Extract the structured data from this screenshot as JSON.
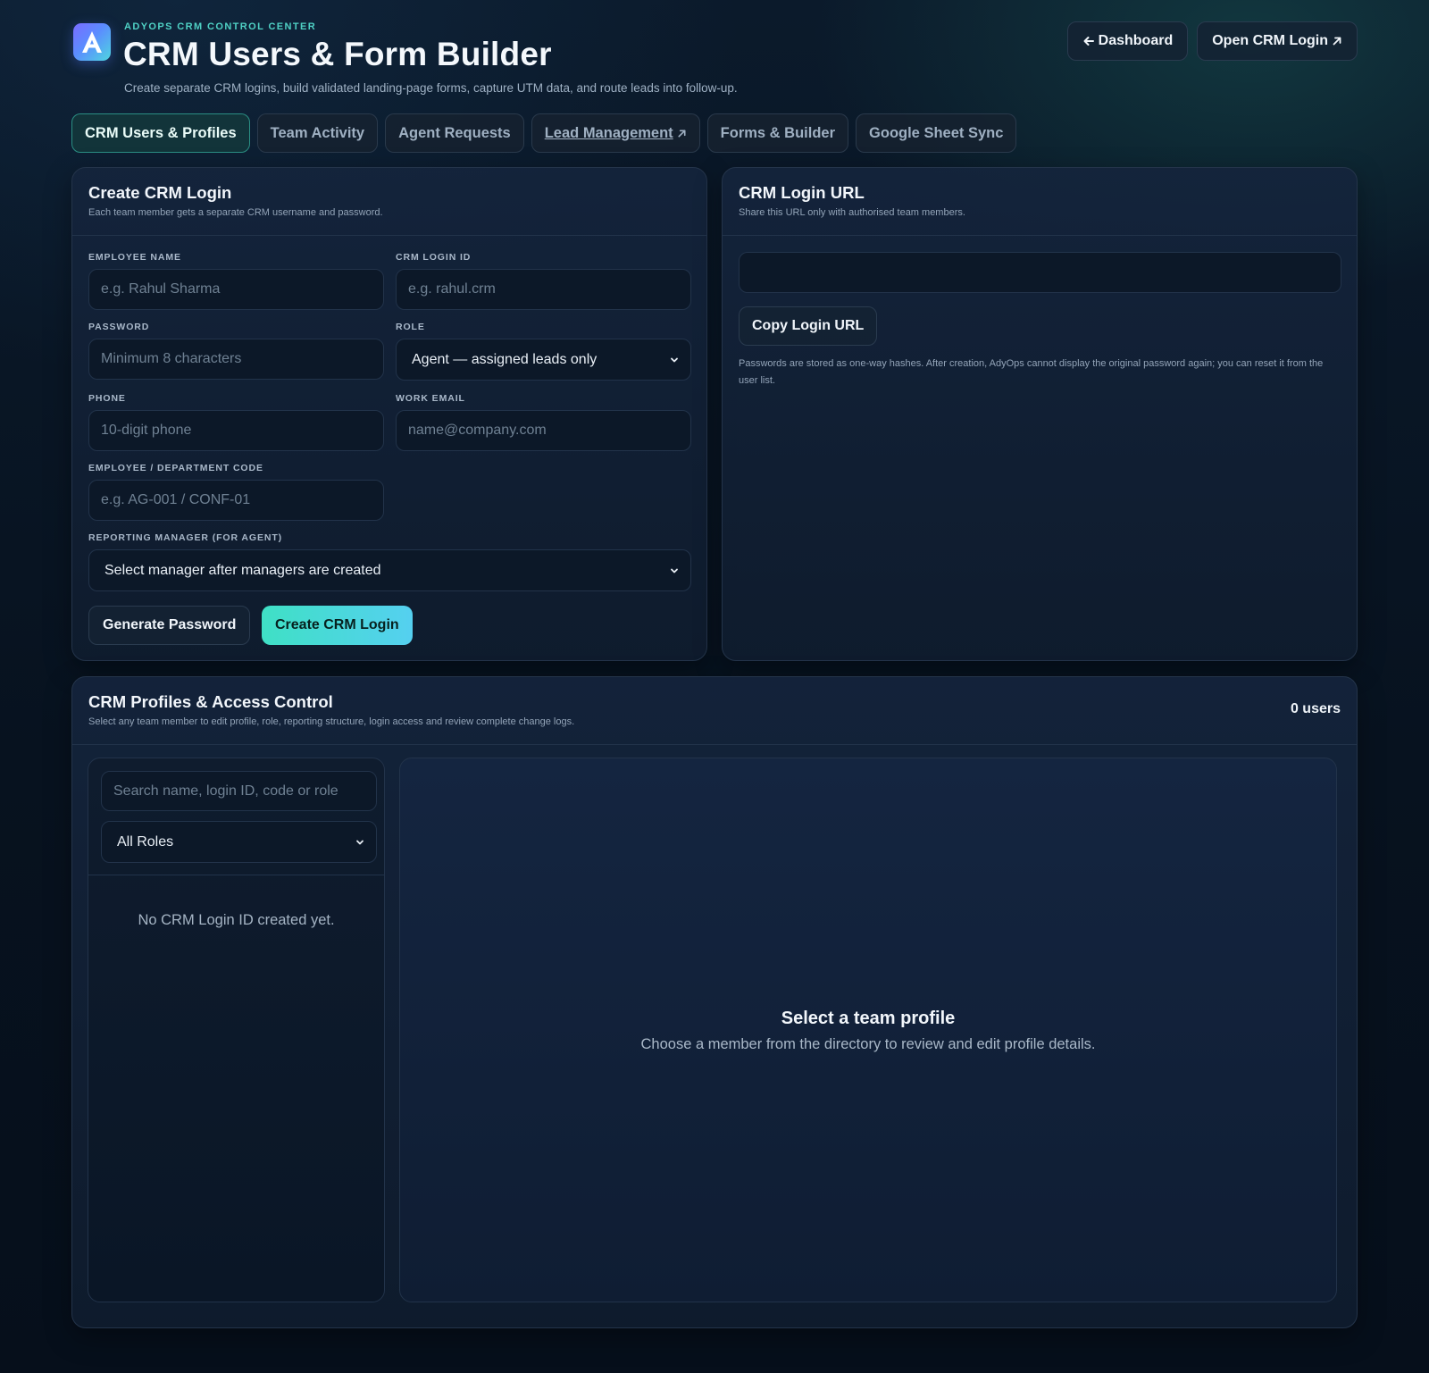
{
  "header": {
    "eyebrow": "ADYOPS CRM CONTROL CENTER",
    "title": "CRM Users & Form Builder",
    "subtitle": "Create separate CRM logins, build validated landing-page forms, capture UTM data, and route leads into follow-up.",
    "dashboard_label": "Dashboard",
    "open_login_label": "Open CRM Login"
  },
  "tabs": [
    {
      "label": "CRM Users & Profiles",
      "active": true
    },
    {
      "label": "Team Activity"
    },
    {
      "label": "Agent Requests"
    },
    {
      "label": "Lead Management",
      "external": true
    },
    {
      "label": "Forms & Builder"
    },
    {
      "label": "Google Sheet Sync"
    }
  ],
  "create_login": {
    "title": "Create CRM Login",
    "subtitle": "Each team member gets a separate CRM username and password.",
    "fields": {
      "employee_name": {
        "label": "EMPLOYEE NAME",
        "placeholder": "e.g. Rahul Sharma"
      },
      "login_id": {
        "label": "CRM LOGIN ID",
        "placeholder": "e.g. rahul.crm"
      },
      "password": {
        "label": "PASSWORD",
        "placeholder": "Minimum 8 characters"
      },
      "role": {
        "label": "ROLE",
        "value": "Agent — assigned leads only"
      },
      "phone": {
        "label": "PHONE",
        "placeholder": "10-digit phone"
      },
      "work_email": {
        "label": "WORK EMAIL",
        "placeholder": "name@company.com"
      },
      "dept_code": {
        "label": "EMPLOYEE / DEPARTMENT CODE",
        "placeholder": "e.g. AG-001 / CONF-01"
      },
      "manager": {
        "label": "REPORTING MANAGER (FOR AGENT)",
        "value": "Select manager after managers are created"
      }
    },
    "generate_label": "Generate Password",
    "create_label": "Create CRM Login"
  },
  "login_url": {
    "title": "CRM Login URL",
    "subtitle": "Share this URL only with authorised team members.",
    "url_value": "",
    "copy_label": "Copy Login URL",
    "note": "Passwords are stored as one-way hashes. After creation, AdyOps cannot display the original password again; you can reset it from the user list."
  },
  "profiles": {
    "title": "CRM Profiles & Access Control",
    "subtitle": "Select any team member to edit profile, role, reporting structure, login access and review complete change logs.",
    "count_label": "0 users",
    "search_placeholder": "Search name, login ID, code or role",
    "role_filter": "All Roles",
    "empty_directory": "No CRM Login ID created yet.",
    "detail_title": "Select a team profile",
    "detail_subtitle": "Choose a member from the directory to review and edit profile details."
  },
  "icons": {
    "logo": "adyops-logo-icon",
    "back": "arrow-left-icon",
    "external": "arrow-up-right-icon",
    "dropdown": "chevron-down-icon"
  },
  "colors": {
    "accent": "#4fd1c5",
    "primary_gradient_start": "#3fe0c5",
    "primary_gradient_end": "#55d0f0",
    "background": "#07121f"
  }
}
